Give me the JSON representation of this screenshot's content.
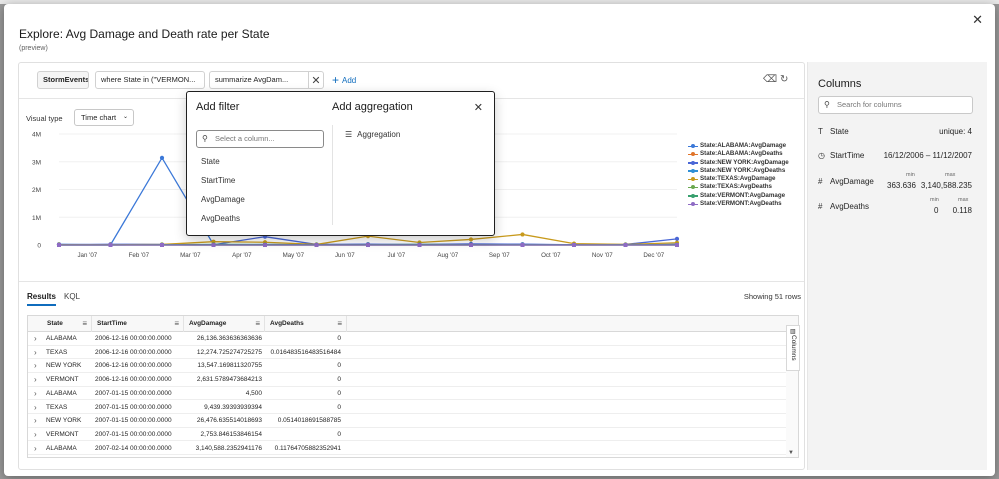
{
  "dialog": {
    "title": "Explore: Avg Damage and Death rate per State",
    "subtitle": "(preview)"
  },
  "query": {
    "source": "StormEvents",
    "where": "where State in (\"VERMON...",
    "summarize": "summarize AvgDam...",
    "add_label": "Add"
  },
  "visual": {
    "label": "Visual type",
    "value": "Time chart"
  },
  "chart_data": {
    "type": "line",
    "x": [
      "2006-12-16",
      "2007-01-15",
      "2007-02-14",
      "2007-03-16",
      "2007-04-15",
      "2007-05-15",
      "2007-06-14",
      "2007-07-14",
      "2007-08-13",
      "2007-09-12",
      "2007-10-12",
      "2007-11-11",
      "2007-12-11"
    ],
    "x_tick_labels": [
      "Jan '07",
      "Feb '07",
      "Mar '07",
      "Apr '07",
      "May '07",
      "Jun '07",
      "Jul '07",
      "Aug '07",
      "Sep '07",
      "Oct '07",
      "Nov '07",
      "Dec '07"
    ],
    "y_tick_labels": [
      "0",
      "1M",
      "2M",
      "3M",
      "4M"
    ],
    "ylim": [
      0,
      4000000
    ],
    "legend_position": "right",
    "series": [
      {
        "name": "State:ALABAMA:AvgDamage",
        "color": "#3b78d8",
        "values": [
          26136,
          4500,
          3140588,
          15000,
          20000,
          10000,
          15000,
          10000,
          20000,
          15000,
          10000,
          10000,
          25000
        ]
      },
      {
        "name": "State:ALABAMA:AvgDeaths",
        "color": "#e0742b",
        "values": [
          0,
          0,
          0.118,
          0,
          0,
          0,
          0,
          0,
          0,
          0,
          0,
          0,
          0
        ]
      },
      {
        "name": "State:NEW YORK:AvgDamage",
        "color": "#4a67d6",
        "values": [
          13547,
          26476,
          20000,
          10000,
          300000,
          20000,
          30000,
          20000,
          40000,
          30000,
          10000,
          20000,
          220000
        ]
      },
      {
        "name": "State:NEW YORK:AvgDeaths",
        "color": "#2f8fd6",
        "values": [
          0,
          0.051,
          0,
          0,
          0,
          0,
          0,
          0,
          0,
          0,
          0,
          0,
          0
        ]
      },
      {
        "name": "State:TEXAS:AvgDamage",
        "color": "#c89a1c",
        "values": [
          12274,
          9439,
          20000,
          120000,
          100000,
          20000,
          320000,
          90000,
          200000,
          380000,
          50000,
          20000,
          80000
        ]
      },
      {
        "name": "State:TEXAS:AvgDeaths",
        "color": "#6aa84f",
        "values": [
          0.016,
          0,
          0,
          0,
          0,
          0,
          0,
          0,
          0,
          0,
          0,
          0,
          0
        ]
      },
      {
        "name": "State:VERMONT:AvgDamage",
        "color": "#38a06e",
        "values": [
          2631,
          2753,
          10000,
          20000,
          15000,
          10000,
          10000,
          20000,
          10000,
          10000,
          5000,
          10000,
          10000
        ]
      },
      {
        "name": "State:VERMONT:AvgDeaths",
        "color": "#8e6bc4",
        "values": [
          0,
          0,
          0,
          0,
          0,
          0,
          0,
          0,
          0,
          0,
          0,
          0,
          0
        ]
      }
    ]
  },
  "results": {
    "tab_results": "Results",
    "tab_kql": "KQL",
    "showing": "Showing 51 rows",
    "columns_rail": "Columns",
    "headers": [
      "State",
      "StartTime",
      "AvgDamage",
      "AvgDeaths"
    ],
    "rows": [
      [
        "ALABAMA",
        "2006-12-16 00:00:00.0000",
        "26,136.363636363636",
        "0"
      ],
      [
        "TEXAS",
        "2006-12-16 00:00:00.0000",
        "12,274.725274725275",
        "0.016483516483516484"
      ],
      [
        "NEW YORK",
        "2006-12-16 00:00:00.0000",
        "13,547.169811320755",
        "0"
      ],
      [
        "VERMONT",
        "2006-12-16 00:00:00.0000",
        "2,631.5789473684213",
        "0"
      ],
      [
        "ALABAMA",
        "2007-01-15 00:00:00.0000",
        "4,500",
        "0"
      ],
      [
        "TEXAS",
        "2007-01-15 00:00:00.0000",
        "9,439.39393939394",
        "0"
      ],
      [
        "NEW YORK",
        "2007-01-15 00:00:00.0000",
        "26,476.635514018693",
        "0.0514018691588785"
      ],
      [
        "VERMONT",
        "2007-01-15 00:00:00.0000",
        "2,753.846153846154",
        "0"
      ],
      [
        "ALABAMA",
        "2007-02-14 00:00:00.0000",
        "3,140,588.2352941176",
        "0.11764705882352941"
      ]
    ]
  },
  "columns_panel": {
    "title": "Columns",
    "search_placeholder": "Search for columns",
    "state": {
      "name": "State",
      "info": "unique: 4"
    },
    "starttime": {
      "name": "StartTime",
      "info": "16/12/2006 – 11/12/2007"
    },
    "avgdamage": {
      "name": "AvgDamage",
      "min_label": "min",
      "max_label": "max",
      "min": "363.636",
      "max": "3,140,588.235"
    },
    "avgdeaths": {
      "name": "AvgDeaths",
      "min_label": "min",
      "max_label": "max",
      "min": "0",
      "max": "0.118"
    }
  },
  "popup": {
    "filter_title": "Add filter",
    "filter_placeholder": "Select a column...",
    "options": [
      "State",
      "StartTime",
      "AvgDamage",
      "AvgDeaths"
    ],
    "agg_title": "Add aggregation",
    "agg_item": "Aggregation"
  }
}
